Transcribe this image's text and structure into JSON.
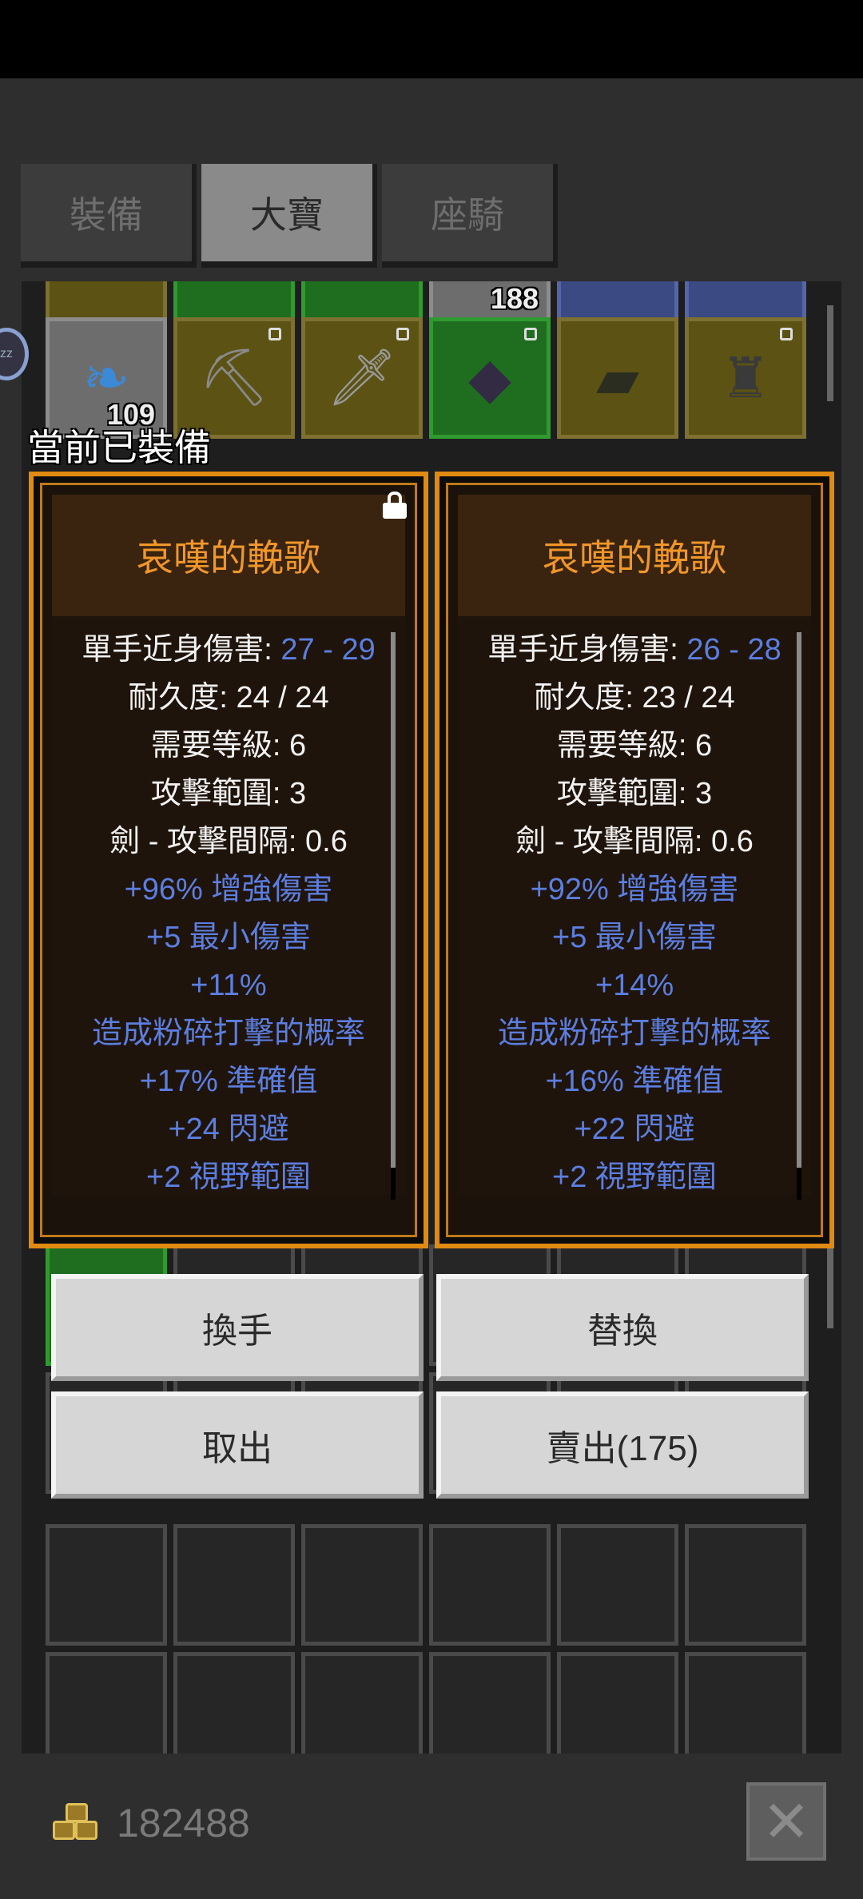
{
  "tabs": [
    {
      "label": "裝備",
      "active": false
    },
    {
      "label": "大寶",
      "active": true
    },
    {
      "label": "座騎",
      "active": false
    }
  ],
  "inventory": {
    "visible_quantities": [
      "188",
      "109"
    ]
  },
  "equipped_label": "當前已裝備",
  "cards": [
    {
      "title": "哀嘆的輓歌",
      "locked": true,
      "stats": [
        {
          "label": "單手近身傷害: ",
          "value": "27 - 29",
          "value_color": "blue"
        },
        {
          "label": "耐久度: ",
          "value": "24 / 24",
          "value_color": "white"
        },
        {
          "label": "需要等級: ",
          "value": "6",
          "value_color": "white"
        },
        {
          "label": "攻擊範圍: ",
          "value": "3",
          "value_color": "white"
        },
        {
          "label": "劍 - 攻擊間隔: ",
          "value": "0.6",
          "value_color": "white"
        }
      ],
      "modifiers": [
        "+96% 增強傷害",
        "+5 最小傷害",
        "+11%",
        "造成粉碎打擊的概率",
        "+17% 準確值",
        "+24 閃避",
        "+2 視野範圍"
      ]
    },
    {
      "title": "哀嘆的輓歌",
      "locked": false,
      "stats": [
        {
          "label": "單手近身傷害: ",
          "value": "26 - 28",
          "value_color": "blue"
        },
        {
          "label": "耐久度: ",
          "value": "23 / 24",
          "value_color": "white"
        },
        {
          "label": "需要等級: ",
          "value": "6",
          "value_color": "white"
        },
        {
          "label": "攻擊範圍: ",
          "value": "3",
          "value_color": "white"
        },
        {
          "label": "劍 - 攻擊間隔: ",
          "value": "0.6",
          "value_color": "white"
        }
      ],
      "modifiers": [
        "+92% 增強傷害",
        "+5 最小傷害",
        "+14%",
        "造成粉碎打擊的概率",
        "+16% 準確值",
        "+22 閃避",
        "+2 視野範圍"
      ]
    }
  ],
  "actions": {
    "swap_hand": "換手",
    "replace": "替換",
    "take_out": "取出",
    "sell": "賣出(175)"
  },
  "footer": {
    "gold": "182488",
    "close_icon": "close-x-icon"
  },
  "colors": {
    "card_border": "#e08a12",
    "title": "#f0962a",
    "modifier_blue": "#5c7ee0"
  }
}
